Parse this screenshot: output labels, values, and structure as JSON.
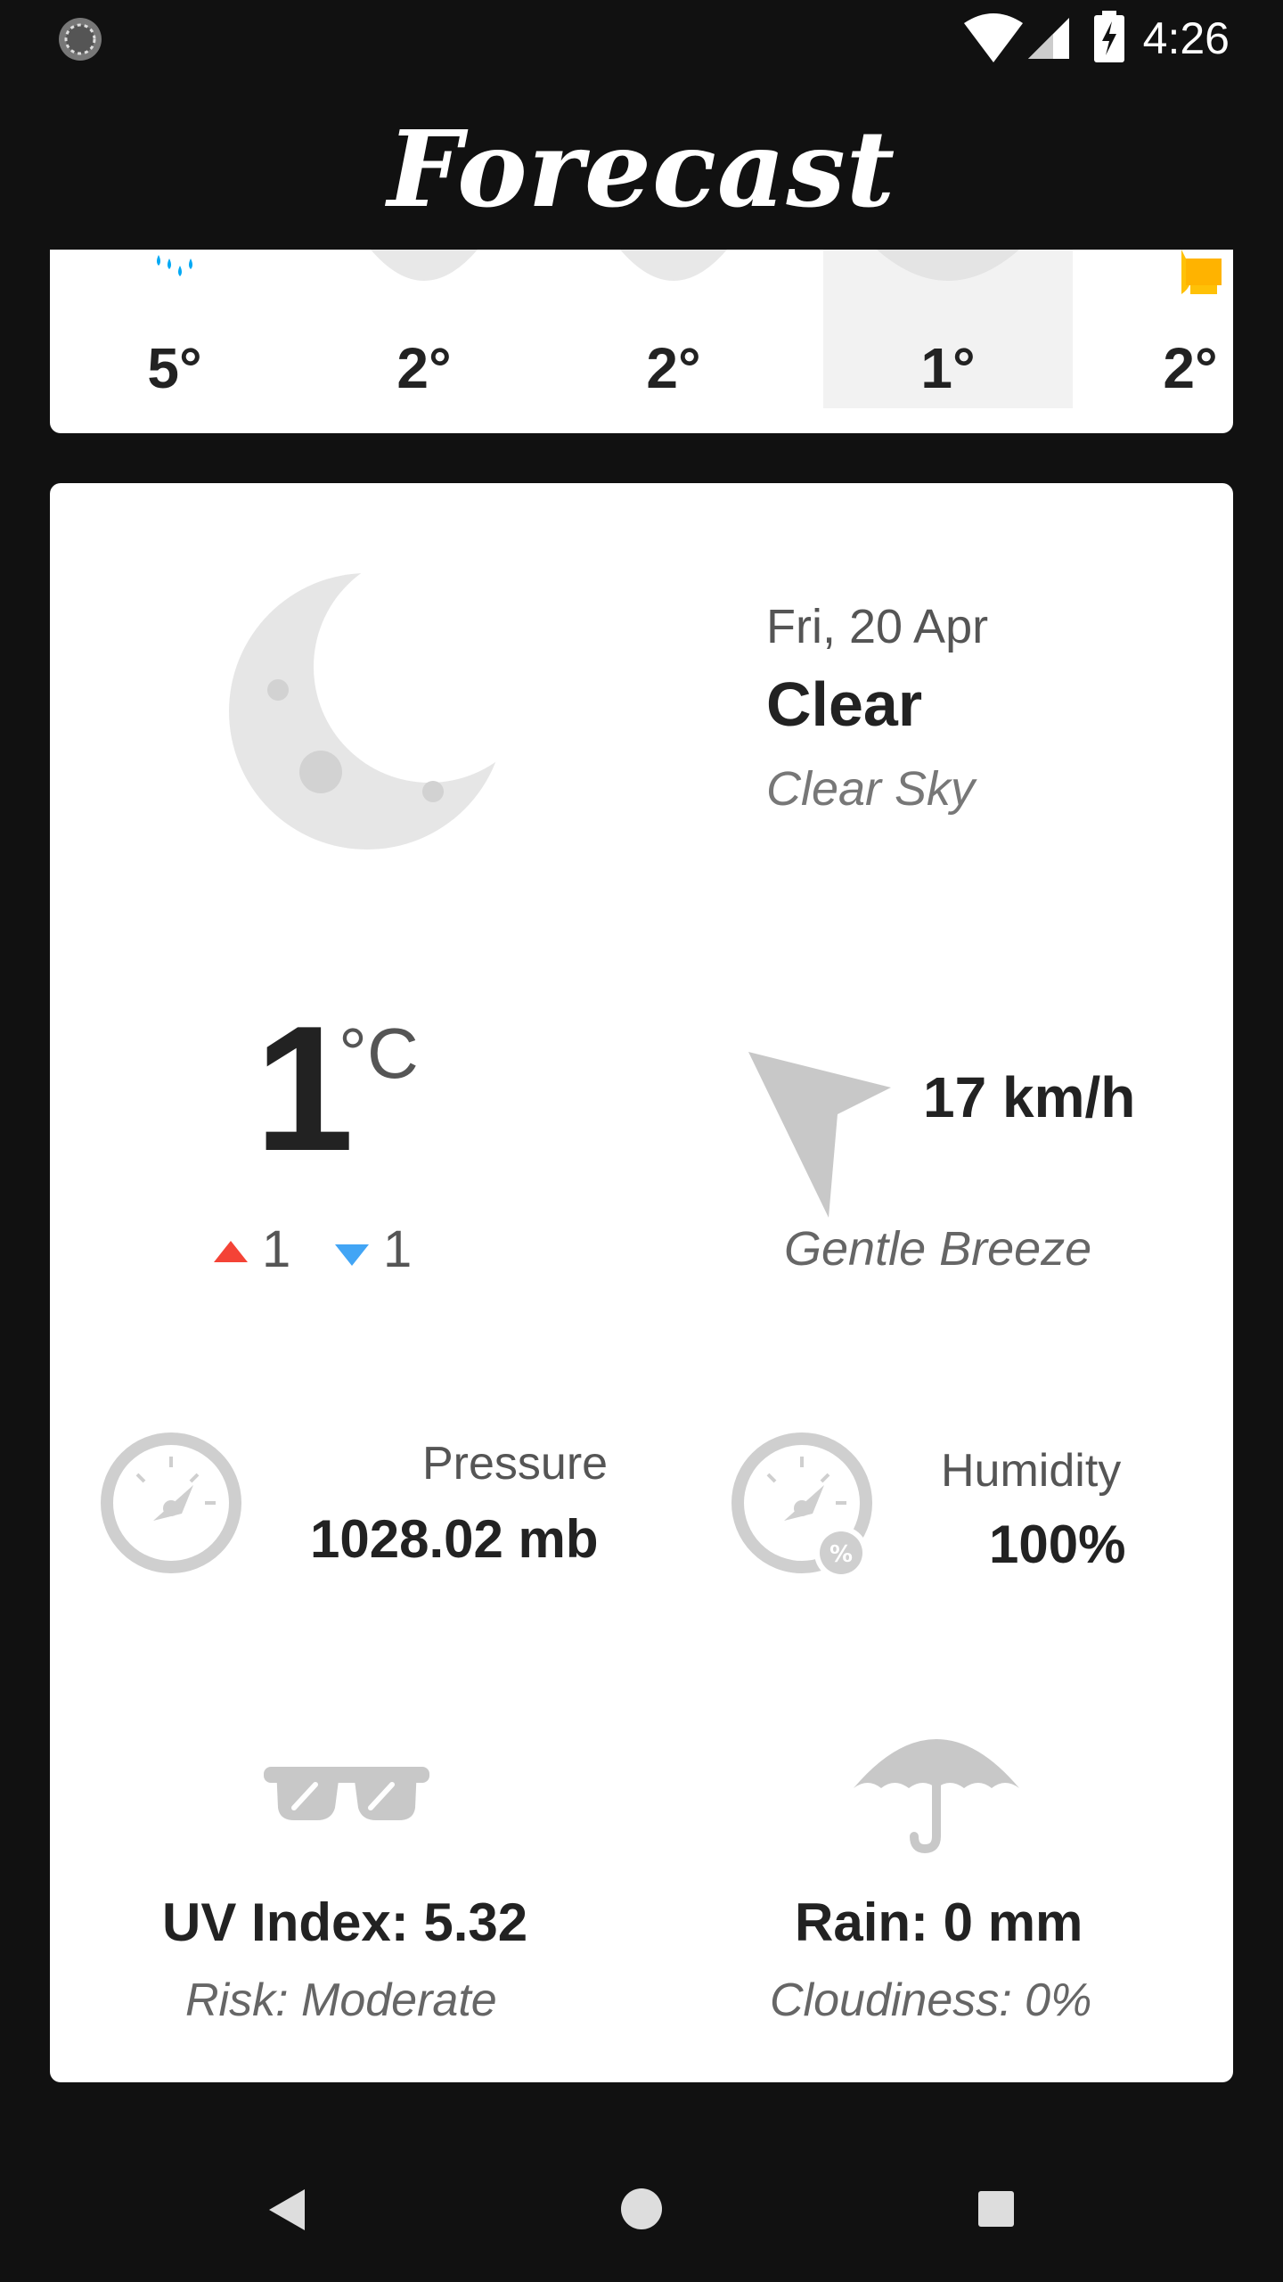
{
  "status_bar": {
    "time": "4:26"
  },
  "app_bar": {
    "title": "Forecast"
  },
  "forecast_strip": {
    "items": [
      {
        "temp": "5°",
        "icon": "rain-drops-icon",
        "selected": false
      },
      {
        "temp": "2°",
        "icon": "moon-icon",
        "selected": false
      },
      {
        "temp": "2°",
        "icon": "moon-icon",
        "selected": false
      },
      {
        "temp": "1°",
        "icon": "moon-icon",
        "selected": true
      },
      {
        "temp": "2°",
        "icon": "sun-icon",
        "selected": false
      }
    ]
  },
  "detail": {
    "date": "Fri, 20 Apr",
    "condition": "Clear",
    "description": "Clear Sky",
    "temperature": "1",
    "temperature_unit": "°C",
    "temp_high": "1",
    "temp_low": "1",
    "wind_speed": "17 km/h",
    "wind_description": "Gentle Breeze",
    "pressure_label": "Pressure",
    "pressure_value": "1028.02 mb",
    "humidity_label": "Humidity",
    "humidity_value": "100%",
    "uv_index": "UV Index: 5.32",
    "uv_risk": "Risk: Moderate",
    "rain": "Rain: 0 mm",
    "cloudiness": "Cloudiness: 0%"
  },
  "colors": {
    "background": "#111111",
    "card": "#ffffff",
    "icon_gray": "#c8c8c8",
    "high_arrow": "#f44336",
    "low_arrow": "#42a5f5",
    "rain_blue": "#03a9f4",
    "sun_yellow": "#ffc107"
  }
}
